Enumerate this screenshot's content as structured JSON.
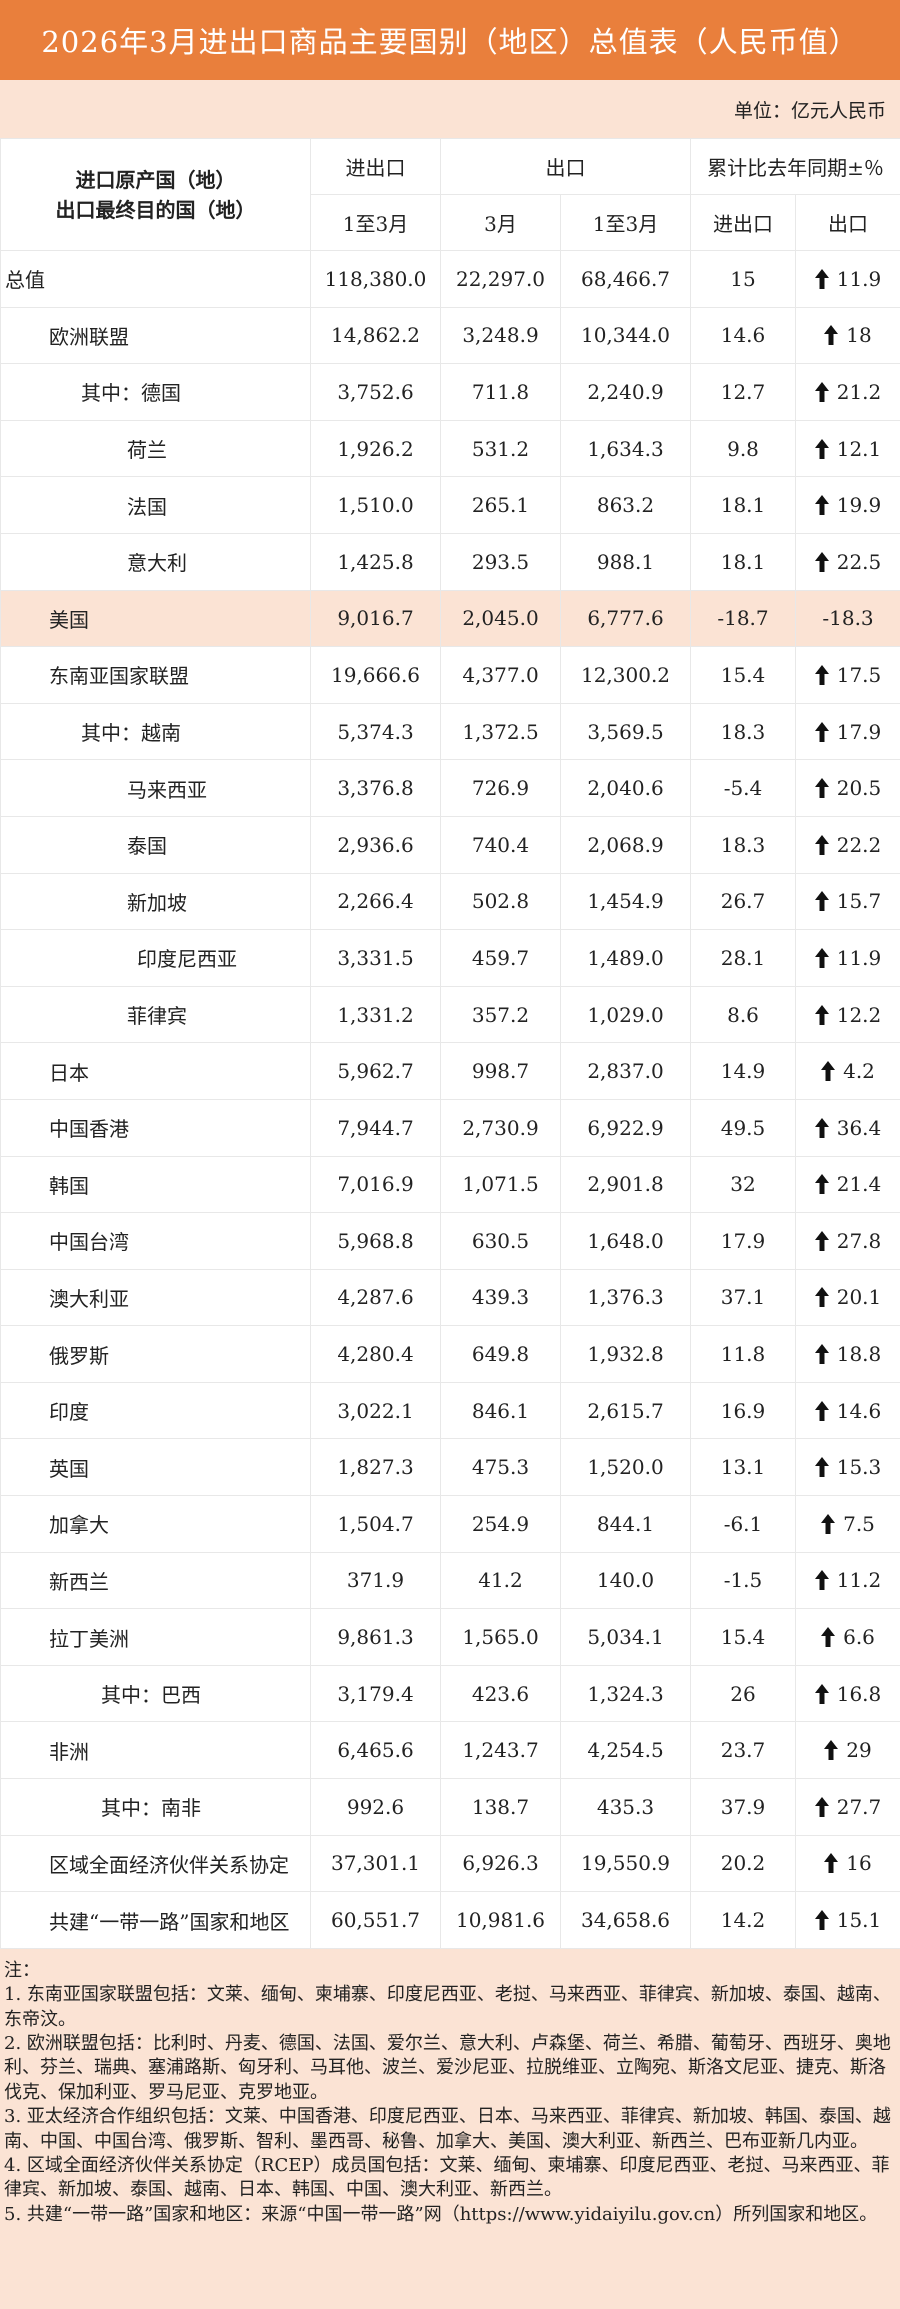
{
  "title": "2026年3月进出口商品主要国别（地区）总值表（人民币值）",
  "unit": "单位：亿元人民币",
  "headers": {
    "country": "进口原产国（地）\n出口最终目的国（地）",
    "trade": "进出口",
    "export": "出口",
    "yoy": "累计比去年同期±％",
    "q1": "1至3月",
    "mar": "3月",
    "q1_export": "1至3月",
    "yoy_trade": "进出口",
    "yoy_export": "出口"
  },
  "rows": [
    {
      "name": "总值",
      "indent": 0,
      "total": "118,380.0",
      "mar": "22,297.0",
      "exp": "68,466.7",
      "yt": "15",
      "ye": "11.9",
      "up": true
    },
    {
      "name": "欧洲联盟",
      "indent": 1,
      "total": "14,862.2",
      "mar": "3,248.9",
      "exp": "10,344.0",
      "yt": "14.6",
      "ye": "18",
      "up": true
    },
    {
      "name": "其中：德国",
      "indent": 2,
      "total": "3,752.6",
      "mar": "711.8",
      "exp": "2,240.9",
      "yt": "12.7",
      "ye": "21.2",
      "up": true
    },
    {
      "name": "荷兰",
      "indent": 3,
      "total": "1,926.2",
      "mar": "531.2",
      "exp": "1,634.3",
      "yt": "9.8",
      "ye": "12.1",
      "up": true
    },
    {
      "name": "法国",
      "indent": 3,
      "total": "1,510.0",
      "mar": "265.1",
      "exp": "863.2",
      "yt": "18.1",
      "ye": "19.9",
      "up": true
    },
    {
      "name": "意大利",
      "indent": 3,
      "total": "1,425.8",
      "mar": "293.5",
      "exp": "988.1",
      "yt": "18.1",
      "ye": "22.5",
      "up": true
    },
    {
      "name": "美国",
      "indent": 1,
      "total": "9,016.7",
      "mar": "2,045.0",
      "exp": "6,777.6",
      "yt": "-18.7",
      "ye": "-18.3",
      "up": false,
      "highlight": true
    },
    {
      "name": "东南亚国家联盟",
      "indent": 1,
      "total": "19,666.6",
      "mar": "4,377.0",
      "exp": "12,300.2",
      "yt": "15.4",
      "ye": "17.5",
      "up": true
    },
    {
      "name": "其中：越南",
      "indent": 2,
      "total": "5,374.3",
      "mar": "1,372.5",
      "exp": "3,569.5",
      "yt": "18.3",
      "ye": "17.9",
      "up": true
    },
    {
      "name": "马来西亚",
      "indent": 3,
      "total": "3,376.8",
      "mar": "726.9",
      "exp": "2,040.6",
      "yt": "-5.4",
      "ye": "20.5",
      "up": true
    },
    {
      "name": "泰国",
      "indent": 3,
      "total": "2,936.6",
      "mar": "740.4",
      "exp": "2,068.9",
      "yt": "18.3",
      "ye": "22.2",
      "up": true
    },
    {
      "name": "新加坡",
      "indent": 3,
      "total": "2,266.4",
      "mar": "502.8",
      "exp": "1,454.9",
      "yt": "26.7",
      "ye": "15.7",
      "up": true
    },
    {
      "name": "印度尼西亚",
      "indent": 4,
      "total": "3,331.5",
      "mar": "459.7",
      "exp": "1,489.0",
      "yt": "28.1",
      "ye": "11.9",
      "up": true
    },
    {
      "name": "菲律宾",
      "indent": 3,
      "total": "1,331.2",
      "mar": "357.2",
      "exp": "1,029.0",
      "yt": "8.6",
      "ye": "12.2",
      "up": true
    },
    {
      "name": "日本",
      "indent": 1,
      "total": "5,962.7",
      "mar": "998.7",
      "exp": "2,837.0",
      "yt": "14.9",
      "ye": "4.2",
      "up": true
    },
    {
      "name": "中国香港",
      "indent": 1,
      "total": "7,944.7",
      "mar": "2,730.9",
      "exp": "6,922.9",
      "yt": "49.5",
      "ye": "36.4",
      "up": true
    },
    {
      "name": "韩国",
      "indent": 1,
      "total": "7,016.9",
      "mar": "1,071.5",
      "exp": "2,901.8",
      "yt": "32",
      "ye": "21.4",
      "up": true
    },
    {
      "name": "中国台湾",
      "indent": 1,
      "total": "5,968.8",
      "mar": "630.5",
      "exp": "1,648.0",
      "yt": "17.9",
      "ye": "27.8",
      "up": true
    },
    {
      "name": "澳大利亚",
      "indent": 1,
      "total": "4,287.6",
      "mar": "439.3",
      "exp": "1,376.3",
      "yt": "37.1",
      "ye": "20.1",
      "up": true
    },
    {
      "name": "俄罗斯",
      "indent": 1,
      "total": "4,280.4",
      "mar": "649.8",
      "exp": "1,932.8",
      "yt": "11.8",
      "ye": "18.8",
      "up": true
    },
    {
      "name": "印度",
      "indent": 1,
      "total": "3,022.1",
      "mar": "846.1",
      "exp": "2,615.7",
      "yt": "16.9",
      "ye": "14.6",
      "up": true
    },
    {
      "name": "英国",
      "indent": 1,
      "total": "1,827.3",
      "mar": "475.3",
      "exp": "1,520.0",
      "yt": "13.1",
      "ye": "15.3",
      "up": true
    },
    {
      "name": "加拿大",
      "indent": 1,
      "total": "1,504.7",
      "mar": "254.9",
      "exp": "844.1",
      "yt": "-6.1",
      "ye": "7.5",
      "up": true
    },
    {
      "name": "新西兰",
      "indent": 1,
      "total": "371.9",
      "mar": "41.2",
      "exp": "140.0",
      "yt": "-1.5",
      "ye": "11.2",
      "up": true
    },
    {
      "name": "拉丁美洲",
      "indent": 1,
      "total": "9,861.3",
      "mar": "1,565.0",
      "exp": "5,034.1",
      "yt": "15.4",
      "ye": "6.6",
      "up": true
    },
    {
      "name": "其中：巴西",
      "indent": 5,
      "total": "3,179.4",
      "mar": "423.6",
      "exp": "1,324.3",
      "yt": "26",
      "ye": "16.8",
      "up": true
    },
    {
      "name": "非洲",
      "indent": 1,
      "total": "6,465.6",
      "mar": "1,243.7",
      "exp": "4,254.5",
      "yt": "23.7",
      "ye": "29",
      "up": true
    },
    {
      "name": "其中：南非",
      "indent": 5,
      "total": "992.6",
      "mar": "138.7",
      "exp": "435.3",
      "yt": "37.9",
      "ye": "27.7",
      "up": true
    },
    {
      "name": "区域全面经济伙伴关系协定",
      "indent": 1,
      "total": "37,301.1",
      "mar": "6,926.3",
      "exp": "19,550.9",
      "yt": "20.2",
      "ye": "16",
      "up": true
    },
    {
      "name": "共建“一带一路”国家和地区",
      "indent": 1,
      "total": "60,551.7",
      "mar": "10,981.6",
      "exp": "34,658.6",
      "yt": "14.2",
      "ye": "15.1",
      "up": true
    }
  ],
  "notes": [
    "注：",
    "1. 东南亚国家联盟包括：文莱、缅甸、柬埔寨、印度尼西亚、老挝、马来西亚、菲律宾、新加坡、泰国、越南、东帝汶。",
    "2. 欧洲联盟包括：比利时、丹麦、德国、法国、爱尔兰、意大利、卢森堡、荷兰、希腊、葡萄牙、西班牙、奥地利、芬兰、瑞典、塞浦路斯、匈牙利、马耳他、波兰、爱沙尼亚、拉脱维亚、立陶宛、斯洛文尼亚、捷克、斯洛伐克、保加利亚、罗马尼亚、克罗地亚。",
    "3. 亚太经济合作组织包括：文莱、中国香港、印度尼西亚、日本、马来西亚、菲律宾、新加坡、韩国、泰国、越南、中国、中国台湾、俄罗斯、智利、墨西哥、秘鲁、加拿大、美国、澳大利亚、新西兰、巴布亚新几内亚。",
    "4. 区域全面经济伙伴关系协定（RCEP）成员国包括：文莱、缅甸、柬埔寨、印度尼西亚、老挝、马来西亚、菲律宾、新加坡、泰国、越南、日本、韩国、中国、澳大利亚、新西兰。",
    "5. 共建“一带一路”国家和地区：来源“中国一带一路”网（https://www.yidaiyilu.gov.cn）所列国家和地区。"
  ],
  "arrow_icon": "up-arrow-icon",
  "colors": {
    "title_bg": "#e97f3c",
    "highlight_bg": "#fbe3d4"
  }
}
